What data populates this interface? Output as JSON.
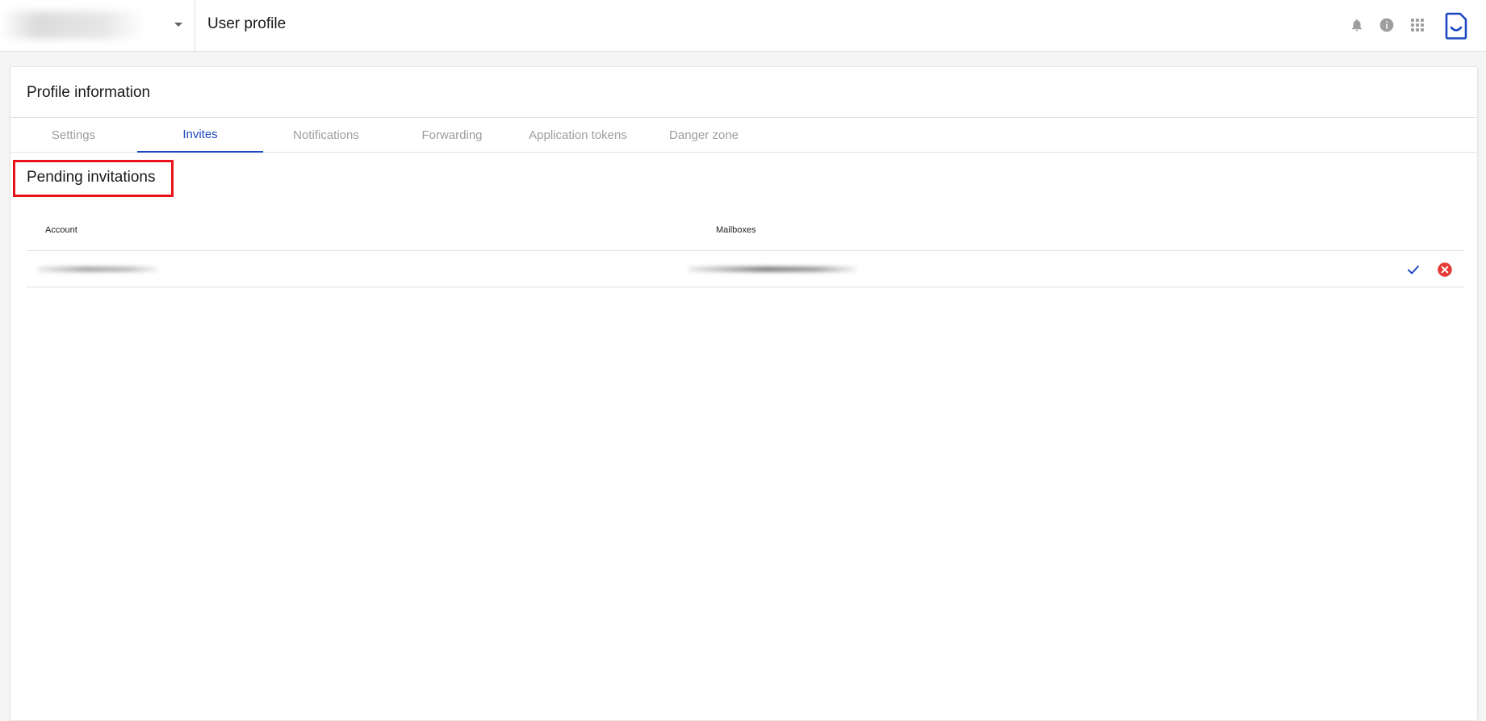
{
  "header": {
    "title": "User profile",
    "account_switcher_icon": "chevron-down-icon",
    "icons": [
      "bell-icon",
      "info-icon",
      "apps-grid-icon",
      "app-logo-icon"
    ]
  },
  "card": {
    "title": "Profile information",
    "tabs": [
      {
        "label": "Settings",
        "active": false
      },
      {
        "label": "Invites",
        "active": true
      },
      {
        "label": "Notifications",
        "active": false
      },
      {
        "label": "Forwarding",
        "active": false
      },
      {
        "label": "Application tokens",
        "active": false
      },
      {
        "label": "Danger zone",
        "active": false
      }
    ]
  },
  "invites": {
    "section_title": "Pending invitations",
    "columns": {
      "account": "Account",
      "mailboxes": "Mailboxes"
    },
    "rows": [
      {
        "account": "",
        "mailboxes": "",
        "actions": [
          "check-icon",
          "cancel-circle-icon"
        ]
      }
    ]
  },
  "colors": {
    "accent": "#1e47c2",
    "highlight_box": "#e8121a",
    "decline": "#e53935",
    "icon_gray": "#9e9e9e"
  }
}
